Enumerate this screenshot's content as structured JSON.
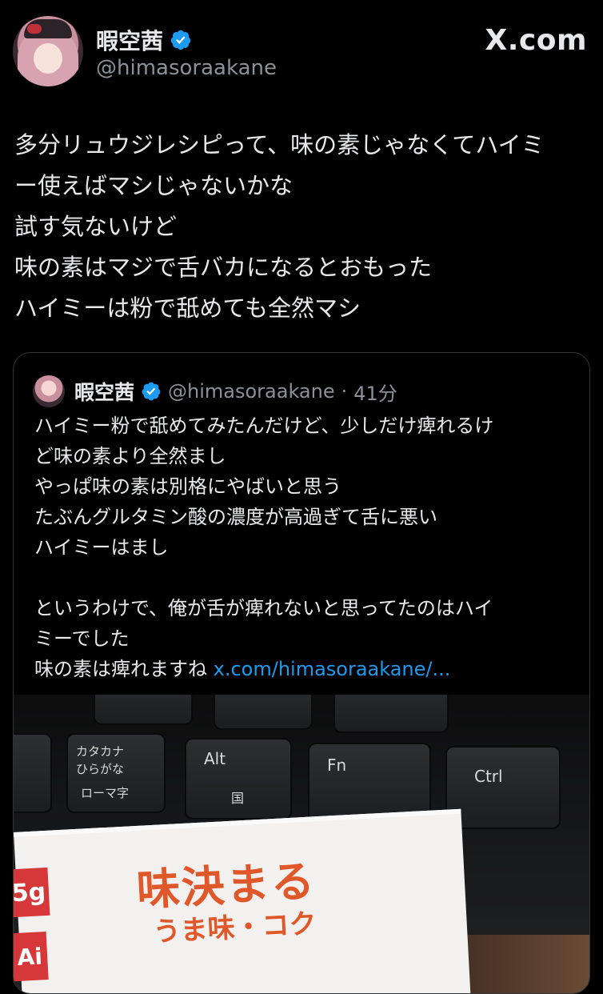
{
  "header": {
    "display_name": "暇空茜",
    "handle": "@himasoraakane",
    "brand": "X.com"
  },
  "tweet": {
    "lines": [
      "多分リュウジレシピって、味の素じゃなくてハイミ",
      "ー使えばマシじゃないかな",
      "試す気ないけど",
      "味の素はマジで舌バカになるとおもった",
      "ハイミーは粉で舐めても全然マシ"
    ]
  },
  "quote": {
    "display_name": "暇空茜",
    "handle": "@himasoraakane",
    "separator": "·",
    "time": "41分",
    "lines": [
      "ハイミー粉で舐めてみたんだけど、少しだけ痺れるけ",
      "ど味の素より全然まし",
      "やっぱ味の素は別格にやばいと思う",
      "たぶんグルタミン酸の濃度が高過ぎて舌に悪い",
      "ハイミーはまし",
      "",
      "というわけで、俺が舌が痺れないと思ってたのはハイ",
      "ミーでした"
    ],
    "last_line_text": "味の素は痺れますね ",
    "link_text": "x.com/himasoraakane/...",
    "photo": {
      "key_labels": {
        "kana_top": "カタカナ",
        "kana_bottom": "ひらがな",
        "romaji": "ローマ字",
        "alt": "Alt",
        "alt_sub": "国",
        "fn": "Fn",
        "ctrl": "Ctrl"
      },
      "packet": {
        "title": "味決まる",
        "subtitle": "うま味・コク",
        "left_badge": "5g",
        "left_badge2": "Ai"
      }
    }
  },
  "colors": {
    "background": "#000000",
    "text": "#e7e9ea",
    "secondary": "#8b9198",
    "link": "#1d9bf0",
    "verified": "#1d9bf0"
  }
}
